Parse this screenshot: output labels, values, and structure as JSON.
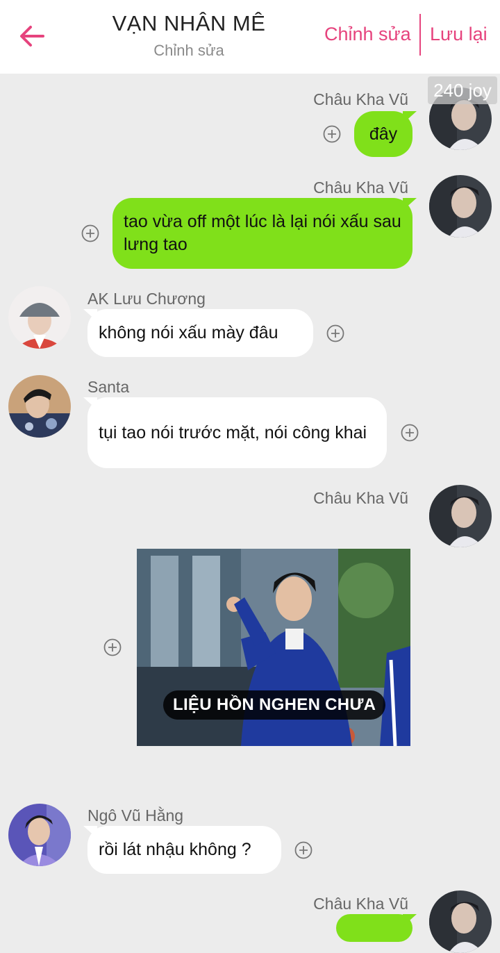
{
  "header": {
    "title": "VẠN NHÂN MÊ",
    "subtitle": "Chỉnh sửa",
    "edit_label": "Chỉnh sửa",
    "save_label": "Lưu lại"
  },
  "badge": "240 joy",
  "messages": [
    {
      "sender": "Châu Kha Vũ",
      "text": "đây"
    },
    {
      "sender": "Châu Kha Vũ",
      "text": "tao vừa off một lúc là lại nói xấu sau lưng tao"
    },
    {
      "sender": "AK Lưu Chương",
      "text": "không nói xấu mày đâu"
    },
    {
      "sender": "Santa",
      "text": "tụi tao nói trước mặt, nói công khai"
    },
    {
      "sender": "Châu Kha Vũ",
      "image_caption": "LIỆU HỒN NGHEN CHƯA"
    },
    {
      "sender": "Ngô Vũ Hằng",
      "text": "rồi lát nhậu không ?"
    },
    {
      "sender": "Châu Kha Vũ",
      "text": ""
    }
  ],
  "colors": {
    "accent": "#e6437d",
    "own_bubble": "#80e01a",
    "other_bubble": "#ffffff",
    "background": "#ececec"
  },
  "icons": {
    "back": "arrow-left-icon",
    "add_reaction": "plus-circle-icon"
  }
}
